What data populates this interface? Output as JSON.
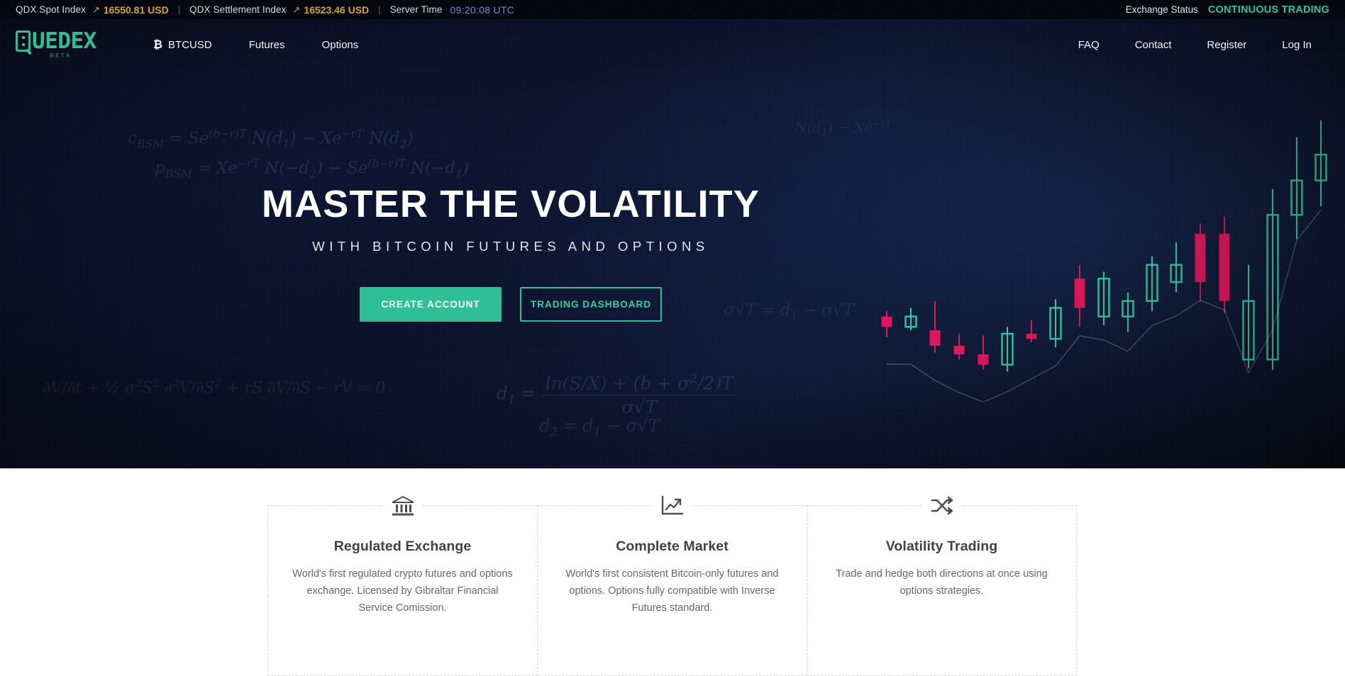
{
  "ticker": {
    "spot_label": "QDX Spot Index",
    "spot_value": "16550.81 USD",
    "settlement_label": "QDX Settlement Index",
    "settlement_value": "16523.46 USD",
    "server_time_label": "Server Time",
    "server_time_value": "09:20:08 UTC",
    "exchange_status_label": "Exchange Status",
    "exchange_status_value": "CONTINUOUS TRADING",
    "separator": "|",
    "arrow": "↗",
    "value_color": "#d9a528",
    "time_color": "#8a7fd0",
    "status_color": "#2ec2a0"
  },
  "brand": {
    "name": "QUEDEX",
    "wordmark": "UEDEX",
    "badge": "BETA",
    "color": "#2fbf95"
  },
  "nav": {
    "main": [
      {
        "label": "BTCUSD",
        "icon": "bitcoin-icon"
      },
      {
        "label": "Futures"
      },
      {
        "label": "Options"
      }
    ],
    "right": [
      {
        "label": "FAQ"
      },
      {
        "label": "Contact"
      },
      {
        "label": "Register"
      },
      {
        "label": "Log In"
      }
    ]
  },
  "hero": {
    "title": "MASTER THE VOLATILITY",
    "subtitle": "WITH BITCOIN FUTURES AND OPTIONS",
    "primary_button": "CREATE ACCOUNT",
    "secondary_button": "TRADING DASHBOARD",
    "accent_color": "#2fbf95",
    "background_color": "#0a0d1e",
    "formulas": [
      "c_BSM = Se^((b-r)T) N(d1) - Xe^(-rT) N(d2)",
      "p_BSM = Xe^(-rT) N(-d2) - Se^((b-r)T) N(-d1)",
      "d1 = [ln(S/X) + (b + σ²/2)T] / (σ√T)",
      "d2 = d1 - σ√T",
      "∂V/∂t + ½ σ² S² ∂²V/∂S² + rS ∂V/∂S - rV = 0"
    ]
  },
  "chart_data": {
    "type": "candlestick",
    "title": "",
    "bull_color": "#2fd4a6",
    "bear_color": "#e8175d",
    "candles": [
      {
        "x": 2,
        "open": 300,
        "high": 318,
        "low": 288,
        "close": 312,
        "dir": "down"
      },
      {
        "x": 3,
        "open": 312,
        "high": 322,
        "low": 296,
        "close": 300,
        "dir": "up"
      },
      {
        "x": 4,
        "open": 296,
        "high": 330,
        "low": 270,
        "close": 278,
        "dir": "down"
      },
      {
        "x": 5,
        "open": 278,
        "high": 292,
        "low": 262,
        "close": 268,
        "dir": "down"
      },
      {
        "x": 6,
        "open": 268,
        "high": 290,
        "low": 250,
        "close": 256,
        "dir": "down"
      },
      {
        "x": 7,
        "open": 256,
        "high": 300,
        "low": 248,
        "close": 292,
        "dir": "up"
      },
      {
        "x": 8,
        "open": 292,
        "high": 308,
        "low": 282,
        "close": 286,
        "dir": "down"
      },
      {
        "x": 9,
        "open": 286,
        "high": 332,
        "low": 276,
        "close": 322,
        "dir": "up"
      },
      {
        "x": 10,
        "open": 322,
        "high": 372,
        "low": 300,
        "close": 356,
        "dir": "down"
      },
      {
        "x": 11,
        "open": 356,
        "high": 364,
        "low": 302,
        "close": 312,
        "dir": "up"
      },
      {
        "x": 12,
        "open": 312,
        "high": 340,
        "low": 294,
        "close": 330,
        "dir": "up"
      },
      {
        "x": 13,
        "open": 330,
        "high": 382,
        "low": 318,
        "close": 372,
        "dir": "up"
      },
      {
        "x": 14,
        "open": 372,
        "high": 398,
        "low": 340,
        "close": 352,
        "dir": "up"
      },
      {
        "x": 15,
        "open": 352,
        "high": 420,
        "low": 330,
        "close": 408,
        "dir": "down"
      },
      {
        "x": 16,
        "open": 408,
        "high": 428,
        "low": 316,
        "close": 330,
        "dir": "down"
      },
      {
        "x": 17,
        "open": 330,
        "high": 372,
        "low": 252,
        "close": 262,
        "dir": "up"
      },
      {
        "x": 18,
        "open": 262,
        "high": 460,
        "low": 250,
        "close": 430,
        "dir": "up"
      },
      {
        "x": 19,
        "open": 430,
        "high": 520,
        "low": 402,
        "close": 470,
        "dir": "up"
      },
      {
        "x": 20,
        "open": 470,
        "high": 540,
        "low": 440,
        "close": 500,
        "dir": "up"
      }
    ],
    "overlay_line": true,
    "grid": false,
    "legend": "none"
  },
  "features": {
    "cards": [
      {
        "icon": "bank-columns-icon",
        "title": "Regulated Exchange",
        "description": "World's first regulated crypto futures and options exchange. Licensed by Gibraltar Financial Service Comission."
      },
      {
        "icon": "chart-trending-up-icon",
        "title": "Complete Market",
        "description": "World's first consistent Bitcoin-only futures and options. Options fully compatible with Inverse Futures standard."
      },
      {
        "icon": "shuffle-arrows-icon",
        "title": "Volatility Trading",
        "description": "Trade and hedge both directions at once using options strategies."
      }
    ]
  }
}
